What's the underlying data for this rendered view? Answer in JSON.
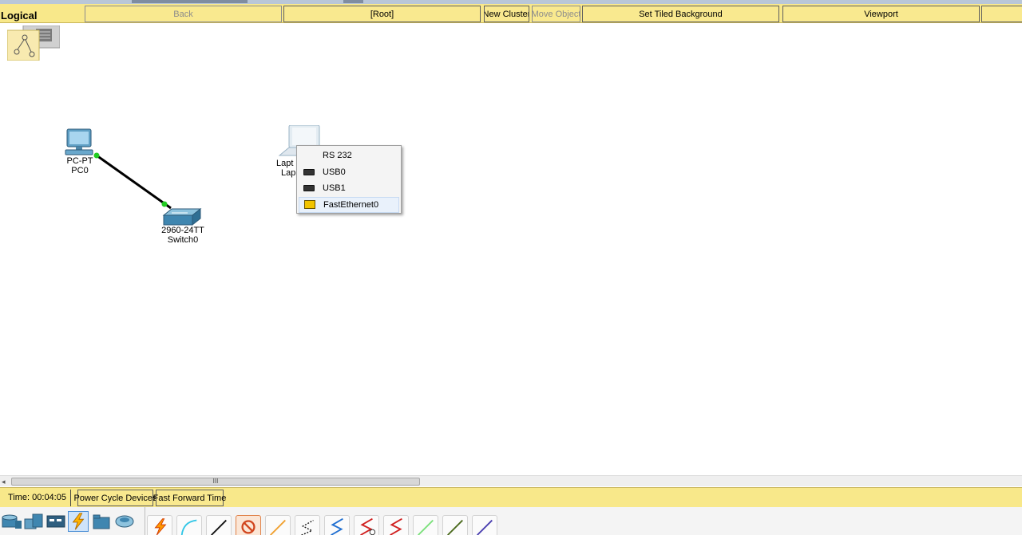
{
  "toolbar": {
    "mode_label": "Logical",
    "back_label": "Back",
    "root_label": "[Root]",
    "new_cluster_label": "New Cluster",
    "move_object_label": "Move Object",
    "tiled_bg_label": "Set Tiled Background",
    "viewport_label": "Viewport"
  },
  "devices": [
    {
      "model": "PC-PT",
      "name": "PC0",
      "icon": "pc-icon"
    },
    {
      "model": "2960-24TT",
      "name": "Switch0",
      "icon": "switch-icon"
    },
    {
      "model": "Lapt",
      "name": "Lap",
      "icon": "laptop-icon"
    }
  ],
  "context_menu": {
    "items": [
      {
        "label": "RS 232",
        "icon": ""
      },
      {
        "label": "USB0",
        "icon": "usb-port-icon"
      },
      {
        "label": "USB1",
        "icon": "usb-port-icon"
      },
      {
        "label": "FastEthernet0",
        "icon": "ethernet-port-icon"
      }
    ],
    "highlighted": "FastEthernet0"
  },
  "scrollbar": {
    "thumb_grip": "III"
  },
  "status": {
    "time": "Time: 00:04:05",
    "power_cycle_label": "Power Cycle Devices",
    "fast_forward_label": "Fast Forward Time"
  },
  "link_color": "#000000",
  "port_up_color": "#22cc22",
  "accent_bar_color": "#f8e88a"
}
